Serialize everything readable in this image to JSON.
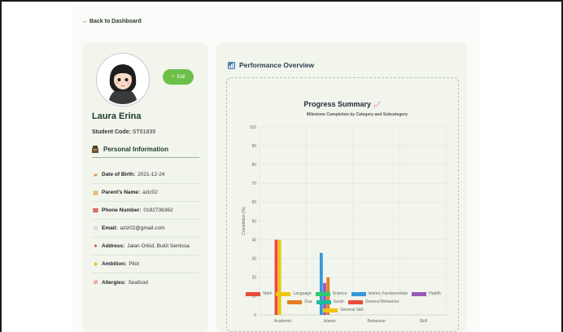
{
  "back_link": "← Back to Dashboard",
  "profile": {
    "edit_label": "Edit",
    "name": "Laura Erina",
    "student_code_label": "Student Code:",
    "student_code": "ST61839",
    "section_title": "Personal Information",
    "fields": [
      {
        "icon": "cake-icon",
        "label": "Date of Birth:",
        "value": "2021-12-24"
      },
      {
        "icon": "family-icon",
        "label": "Parent's Name:",
        "value": "aziz02"
      },
      {
        "icon": "phone-icon",
        "label": "Phone Number:",
        "value": "0182736362"
      },
      {
        "icon": "envelope-icon",
        "label": "Email:",
        "value": "aziz02@gmail.com"
      },
      {
        "icon": "pin-icon",
        "label": "Address:",
        "value": "Jalan Orkid, Bukit Sentosa"
      },
      {
        "icon": "star-icon",
        "label": "Ambition:",
        "value": "Pilot"
      },
      {
        "icon": "no-entry-icon",
        "label": "Allergies:",
        "value": "Seafood"
      }
    ]
  },
  "performance": {
    "title": "Performance Overview",
    "summary_title": "Progress Summary"
  },
  "chart_data": {
    "type": "bar",
    "title": "Milestone Completion by Category and Subcategory",
    "ylabel": "Completion (%)",
    "xlabel": "",
    "ylim": [
      0,
      100
    ],
    "yticks": [
      0,
      10,
      20,
      30,
      40,
      50,
      60,
      70,
      80,
      90,
      100
    ],
    "categories": [
      "Academic",
      "Islamic",
      "Behaviour",
      "Skill"
    ],
    "grid": true,
    "legend_position": "bottom",
    "series": [
      {
        "name": "Math",
        "color": "#e74c3c",
        "values": [
          40,
          0,
          0,
          0
        ]
      },
      {
        "name": "Language",
        "color": "#f1c40f",
        "values": [
          40,
          0,
          0,
          0
        ]
      },
      {
        "name": "Science",
        "color": "#2ecc71",
        "values": [
          0,
          0,
          0,
          0
        ]
      },
      {
        "name": "Islamic Fundamentals",
        "color": "#3498db",
        "values": [
          0,
          33,
          0,
          0
        ]
      },
      {
        "name": "Hadith",
        "color": "#9b59b6",
        "values": [
          0,
          17,
          0,
          0
        ]
      },
      {
        "name": "Dua",
        "color": "#e67e22",
        "values": [
          0,
          20,
          0,
          0
        ]
      },
      {
        "name": "Surah",
        "color": "#1abc9c",
        "values": [
          0,
          0,
          0,
          0
        ]
      },
      {
        "name": "General Behaviour",
        "color": "#e74c3c",
        "values": [
          0,
          0,
          0,
          0
        ]
      },
      {
        "name": "General Skill",
        "color": "#f1c40f",
        "values": [
          0,
          0,
          0,
          0
        ]
      }
    ]
  }
}
